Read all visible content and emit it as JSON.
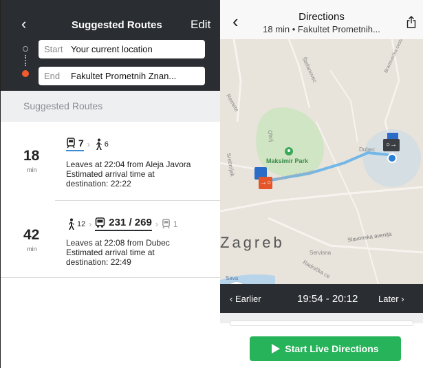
{
  "left_panel": {
    "header": {
      "title": "Suggested Routes",
      "edit_label": "Edit",
      "back_icon": "‹",
      "start_label": "Start",
      "start_value": "Your current location",
      "end_label": "End",
      "end_value": "Fakultet Prometnih Znan..."
    },
    "section_title": "Suggested Routes",
    "routes": [
      {
        "minutes": "18",
        "min_label": "min",
        "segments": {
          "tram": "7",
          "walk": "6"
        },
        "leaves": "Leaves at 22:04 from Aleja Javora",
        "arrival_line1": "Estimated arrival time at",
        "arrival_line2": "destination: 22:22"
      },
      {
        "minutes": "42",
        "min_label": "min",
        "segments": {
          "walk": "12",
          "bus": "231 / 269",
          "tram": "1"
        },
        "leaves": "Leaves at 22:08 from Dubec",
        "arrival_line1": "Estimated arrival time at",
        "arrival_line2": "destination: 22:49"
      }
    ]
  },
  "right_panel": {
    "header": {
      "title": "Directions",
      "subtitle": "18 min • Fakultet Prometnih...",
      "back_icon": "‹",
      "share_icon": "share-icon"
    },
    "map_labels": {
      "park": "Maksimir Park",
      "city": "Zagreb",
      "street_servisna": "Servisna",
      "street_slavonska": "Slavonska avenija",
      "street_radnicka": "Radnička ce",
      "street_sava": "Sava",
      "street_remete": "Remete",
      "street_stefanovec": "Štefanovec",
      "street_bra": "Branovečka cesta",
      "street_oboj": "Oboj",
      "street_srebrnjak": "Srebrnjak",
      "street_maksimirska": "Maksimirska cesta",
      "street_dubec": "Dubec"
    },
    "time_bar": {
      "earlier": "Earlier",
      "range": "19:54 - 20:12",
      "later": "Later"
    },
    "start_button": "Start Live Directions"
  },
  "colors": {
    "header_dark": "#2a2d31",
    "accent_green": "#27b35a",
    "route_blue": "#3d8bd4",
    "end_dot": "#f25c2d"
  }
}
